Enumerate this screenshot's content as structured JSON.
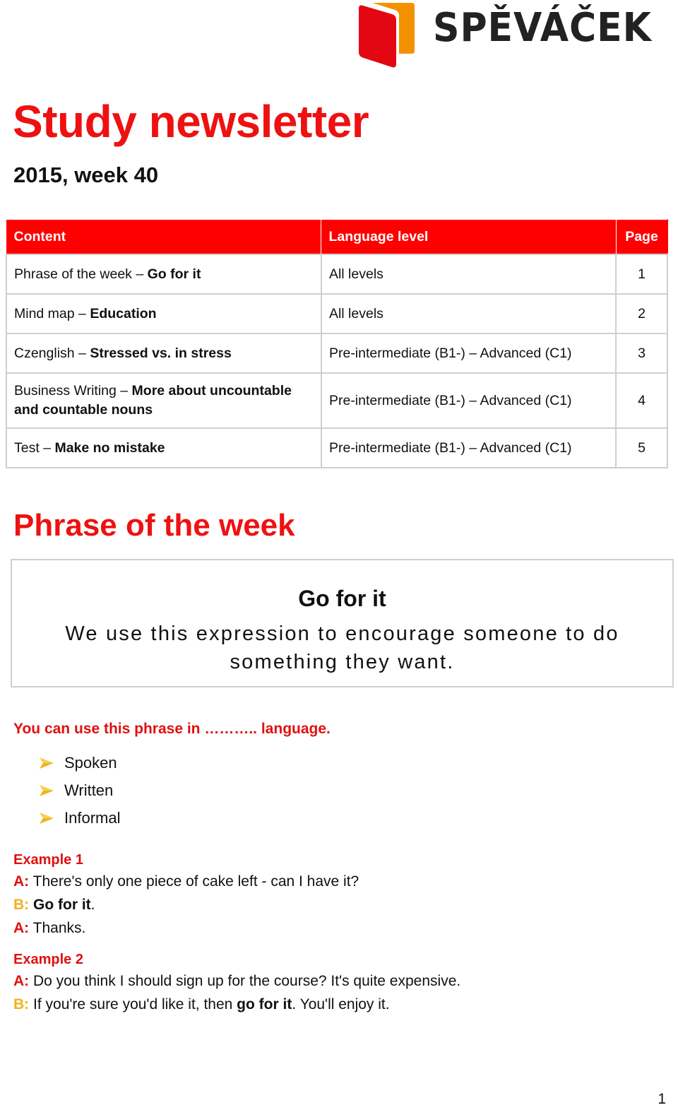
{
  "brand": {
    "name": "SPĚVÁČEK",
    "colors": {
      "red": "#e30613",
      "orange": "#f39200",
      "text": "#222222"
    }
  },
  "header": {
    "title": "Study newsletter",
    "subtitle": "2015, week 40"
  },
  "toc": {
    "columns": [
      "Content",
      "Language level",
      "Page"
    ],
    "rows": [
      {
        "prefix": "Phrase of the week – ",
        "bold": "Go for it",
        "level": "All levels",
        "page": "1"
      },
      {
        "prefix": "Mind map – ",
        "bold": "Education",
        "level": "All levels",
        "page": "2"
      },
      {
        "prefix": "Czenglish – ",
        "bold": "Stressed vs. in stress",
        "level": "Pre-intermediate (B1-) – Advanced (C1)",
        "page": "3"
      },
      {
        "prefix": "Business Writing – ",
        "bold": "More about uncountable and countable nouns",
        "level": "Pre-intermediate (B1-) – Advanced (C1)",
        "page": "4"
      },
      {
        "prefix": "Test – ",
        "bold": "Make no mistake",
        "level": "Pre-intermediate (B1-) – Advanced (C1)",
        "page": "5"
      }
    ]
  },
  "phrase_section": {
    "heading": "Phrase of the week",
    "phrase": "Go for it",
    "definition": "We use this expression to encourage someone to do something they want.",
    "usage_question": "You can use this phrase in ……….. language.",
    "usage_items": [
      "Spoken",
      "Written",
      "Informal"
    ],
    "examples": [
      {
        "label": "Example 1",
        "lines": [
          {
            "speaker": "A:",
            "before": " There's only one piece of cake left - can I have it?",
            "bold": "",
            "after": ""
          },
          {
            "speaker": "B:",
            "before": " ",
            "bold": "Go for it",
            "after": "."
          },
          {
            "speaker": "A:",
            "before": " Thanks.",
            "bold": "",
            "after": ""
          }
        ]
      },
      {
        "label": "Example 2",
        "lines": [
          {
            "speaker": "A:",
            "before": " Do you think I should sign up for the course? It's quite expensive.",
            "bold": "",
            "after": ""
          },
          {
            "speaker": "B:",
            "before": " If you're sure you'd like it, then ",
            "bold": "go for it",
            "after": ". You'll enjoy it."
          }
        ]
      }
    ]
  },
  "footer": {
    "page_number": "1"
  }
}
